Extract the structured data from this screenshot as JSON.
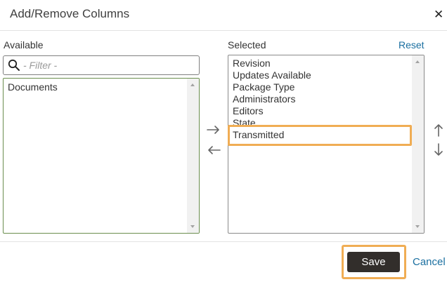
{
  "dialog": {
    "title": "Add/Remove Columns",
    "close_icon": "close-icon"
  },
  "available": {
    "label": "Available",
    "filter_placeholder": "- Filter -",
    "filter_value": "",
    "items": [
      "Documents"
    ]
  },
  "selected": {
    "label": "Selected",
    "reset_label": "Reset",
    "items": [
      "Revision",
      "Updates Available",
      "Package Type",
      "Administrators",
      "Editors",
      "State",
      "Transmitted"
    ]
  },
  "controls": {
    "move_right_icon": "arrow-right-icon",
    "move_left_icon": "arrow-left-icon",
    "move_up_icon": "arrow-up-icon",
    "move_down_icon": "arrow-down-icon"
  },
  "footer": {
    "save_label": "Save",
    "cancel_label": "Cancel"
  },
  "colors": {
    "highlight": "#f0ad54",
    "link": "#1a6fa0",
    "save_bg": "#322e2b",
    "available_border": "#6b8e4e"
  }
}
